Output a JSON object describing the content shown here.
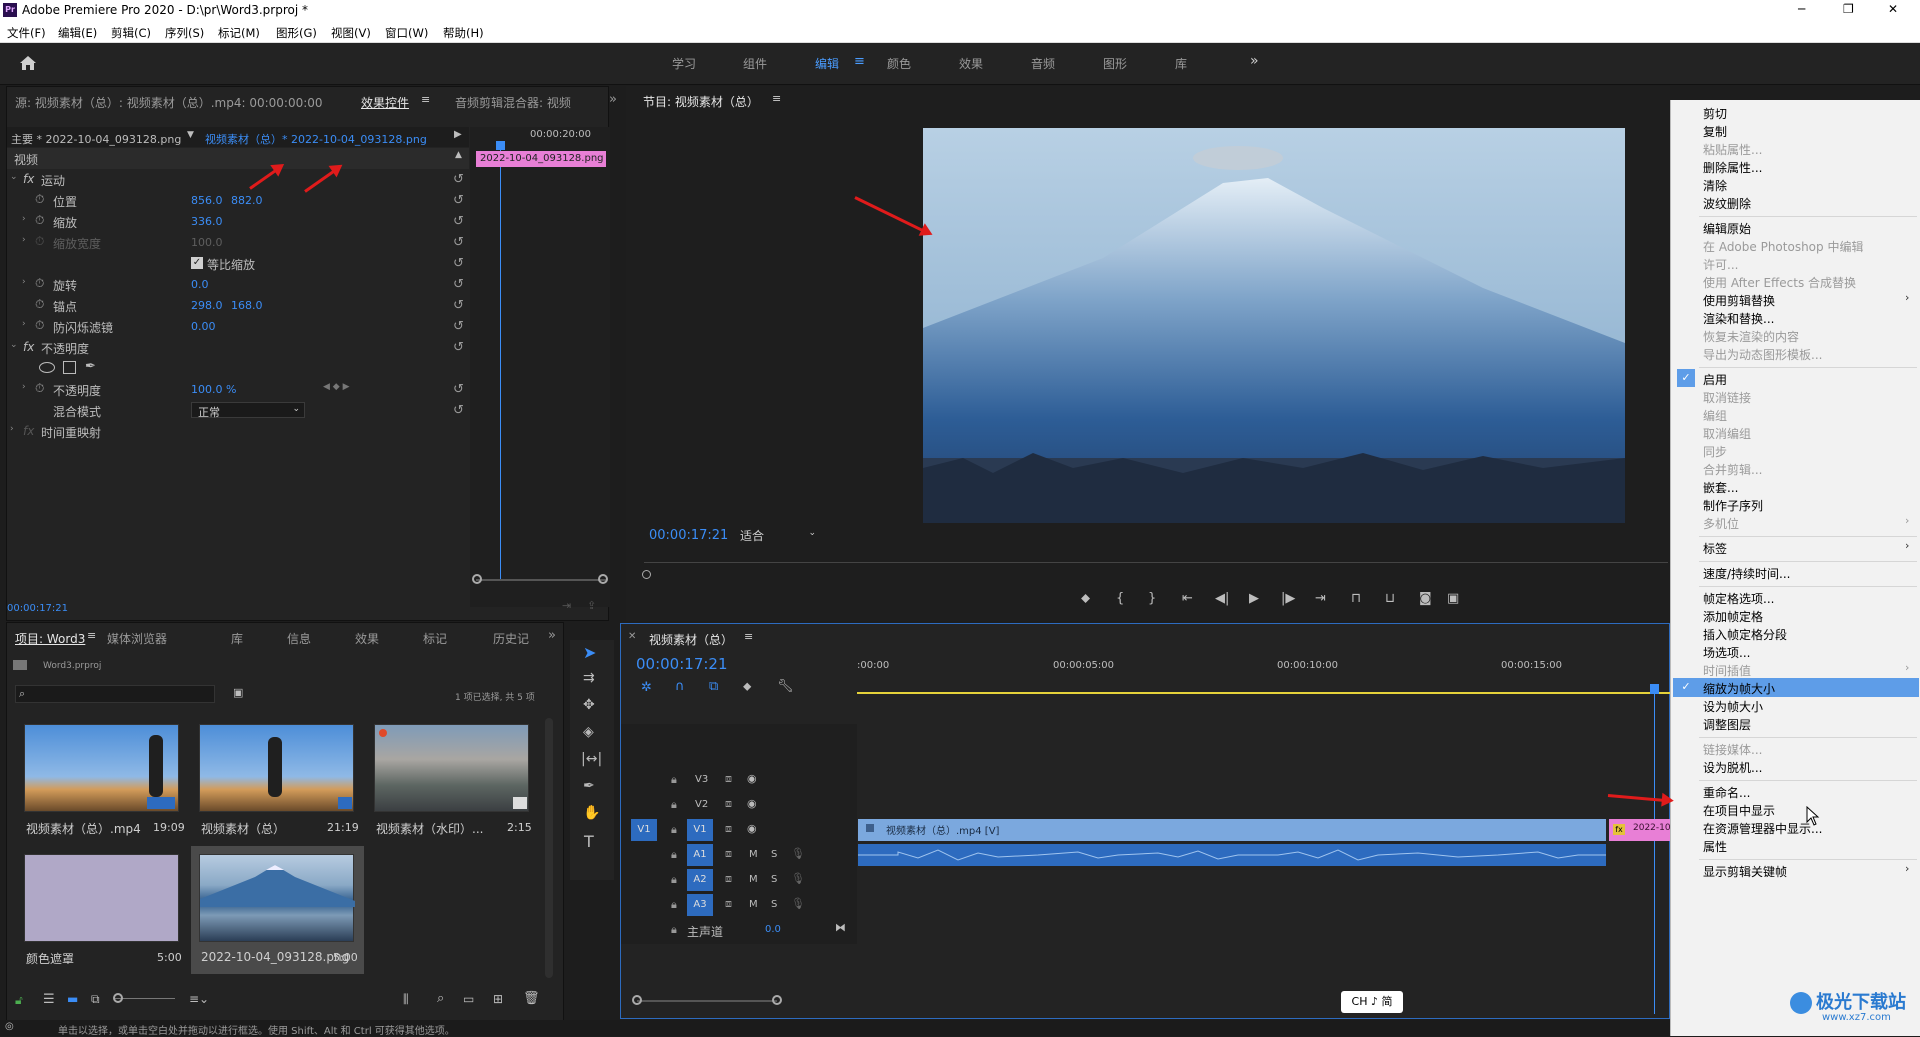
{
  "window": {
    "title": "Adobe Premiere Pro 2020 - D:\\pr\\Word3.prproj *",
    "app_badge": "Pr",
    "min": "─",
    "max": "❐",
    "close": "✕"
  },
  "menu": [
    "文件(F)",
    "编辑(E)",
    "剪辑(C)",
    "序列(S)",
    "标记(M)",
    "图形(G)",
    "视图(V)",
    "窗口(W)",
    "帮助(H)"
  ],
  "workspaces": {
    "items": [
      "学习",
      "组件",
      "编辑",
      "颜色",
      "效果",
      "音频",
      "图形",
      "库"
    ],
    "active": "编辑",
    "more": "»"
  },
  "source_panel": {
    "tab_source": "源: 视频素材（总）: 视频素材（总）.mp4: 00:00:00:00",
    "tab_effects": "效果控件",
    "tab_audio": "音频剪辑混合器: 视频",
    "overflow": "»",
    "master_label": "主要 * 2022-10-04_093128.png",
    "sequence_clip": "视频素材（总）* 2022-10-04_093128.png",
    "mini_time": "00:00:20:00",
    "clip_bar": "2022-10-04_093128.png",
    "section_video": "视频",
    "motion": "运动",
    "position": {
      "label": "位置",
      "x": "856.0",
      "y": "882.0"
    },
    "scale": {
      "label": "缩放",
      "value": "336.0"
    },
    "scale_width": {
      "label": "缩放宽度",
      "value": "100.0"
    },
    "uniform": "等比缩放",
    "rotation": {
      "label": "旋转",
      "value": "0.0"
    },
    "anchor": {
      "label": "锚点",
      "x": "298.0",
      "y": "168.0"
    },
    "antiflicker": {
      "label": "防闪烁滤镜",
      "value": "0.00"
    },
    "opacity_group": "不透明度",
    "opacity": {
      "label": "不透明度",
      "value": "100.0 %"
    },
    "blend": {
      "label": "混合模式",
      "value": "正常"
    },
    "time_remap": "时间重映射",
    "timecode": "00:00:17:21"
  },
  "program": {
    "tab": "节目: 视频素材（总）",
    "timecode": "00:00:17:21",
    "fit": "适合"
  },
  "project": {
    "tabs": [
      "项目: Word3",
      "媒体浏览器",
      "库",
      "信息",
      "效果",
      "标记",
      "历史记"
    ],
    "file": "Word3.prproj",
    "selection": "1 项已选择, 共 5 项",
    "items": [
      {
        "name": "视频素材（总）.mp4",
        "dur": "19:09"
      },
      {
        "name": "视频素材（总）",
        "dur": "21:19"
      },
      {
        "name": "视频素材（水印）...",
        "dur": "2:15"
      },
      {
        "name": "颜色遮罩",
        "dur": "5:00"
      },
      {
        "name": "2022-10-04_093128.png",
        "dur": "5:00"
      }
    ]
  },
  "timeline": {
    "tab": "视频素材（总）",
    "timecode": "00:00:17:21",
    "ruler": [
      ":00:00",
      "00:00:05:00",
      "00:00:10:00",
      "00:00:15:00"
    ],
    "tracks": [
      "V3",
      "V2",
      "V1",
      "A1",
      "A2",
      "A3"
    ],
    "v1_src": "V1",
    "master": "主声道",
    "master_val": "0.0",
    "clip_video": "视频素材（总）.mp4 [V]",
    "clip_png": "2022-10",
    "ime": "CH ♪ 简"
  },
  "status": "单击以选择，或单击空白处并拖动以进行框选。使用 Shift、Alt 和 Ctrl 可获得其他选项。",
  "context_menu": [
    {
      "t": "剪切",
      "d": false
    },
    {
      "t": "复制",
      "d": false
    },
    {
      "t": "粘贴属性...",
      "d": true
    },
    {
      "t": "删除属性...",
      "d": false
    },
    {
      "t": "清除",
      "d": false
    },
    {
      "t": "波纹删除",
      "d": false
    },
    {
      "sep": true
    },
    {
      "t": "编辑原始",
      "d": false
    },
    {
      "t": "在 Adobe Photoshop 中编辑",
      "d": true
    },
    {
      "t": "许可...",
      "d": true
    },
    {
      "t": "使用 After Effects 合成替换",
      "d": true
    },
    {
      "t": "使用剪辑替换",
      "d": false,
      "sub": true
    },
    {
      "t": "渲染和替换...",
      "d": false
    },
    {
      "t": "恢复未渲染的内容",
      "d": true
    },
    {
      "t": "导出为动态图形模板...",
      "d": true
    },
    {
      "sep": true
    },
    {
      "t": "启用",
      "d": false,
      "check": true
    },
    {
      "t": "取消链接",
      "d": true
    },
    {
      "t": "编组",
      "d": true
    },
    {
      "t": "取消编组",
      "d": true
    },
    {
      "t": "同步",
      "d": true
    },
    {
      "t": "合并剪辑...",
      "d": true
    },
    {
      "t": "嵌套...",
      "d": false
    },
    {
      "t": "制作子序列",
      "d": false
    },
    {
      "t": "多机位",
      "d": true,
      "sub": true
    },
    {
      "sep": true
    },
    {
      "t": "标签",
      "d": false,
      "sub": true
    },
    {
      "sep": true
    },
    {
      "t": "速度/持续时间...",
      "d": false
    },
    {
      "sep": true
    },
    {
      "t": "帧定格选项...",
      "d": false
    },
    {
      "t": "添加帧定格",
      "d": false
    },
    {
      "t": "插入帧定格分段",
      "d": false
    },
    {
      "t": "场选项...",
      "d": false
    },
    {
      "t": "时间插值",
      "d": true,
      "sub": true
    },
    {
      "t": "缩放为帧大小",
      "d": false,
      "check": true,
      "hl": true
    },
    {
      "t": "设为帧大小",
      "d": false
    },
    {
      "t": "调整图层",
      "d": false
    },
    {
      "sep": true
    },
    {
      "t": "链接媒体...",
      "d": true
    },
    {
      "t": "设为脱机...",
      "d": false
    },
    {
      "sep": true
    },
    {
      "t": "重命名...",
      "d": false
    },
    {
      "t": "在项目中显示",
      "d": false
    },
    {
      "t": "在资源管理器中显示...",
      "d": false
    },
    {
      "t": "属性",
      "d": false
    },
    {
      "sep": true
    },
    {
      "t": "显示剪辑关键帧",
      "d": false,
      "sub": true
    }
  ],
  "watermark": {
    "text": "极光下载站",
    "url": "www.xz7.com"
  }
}
